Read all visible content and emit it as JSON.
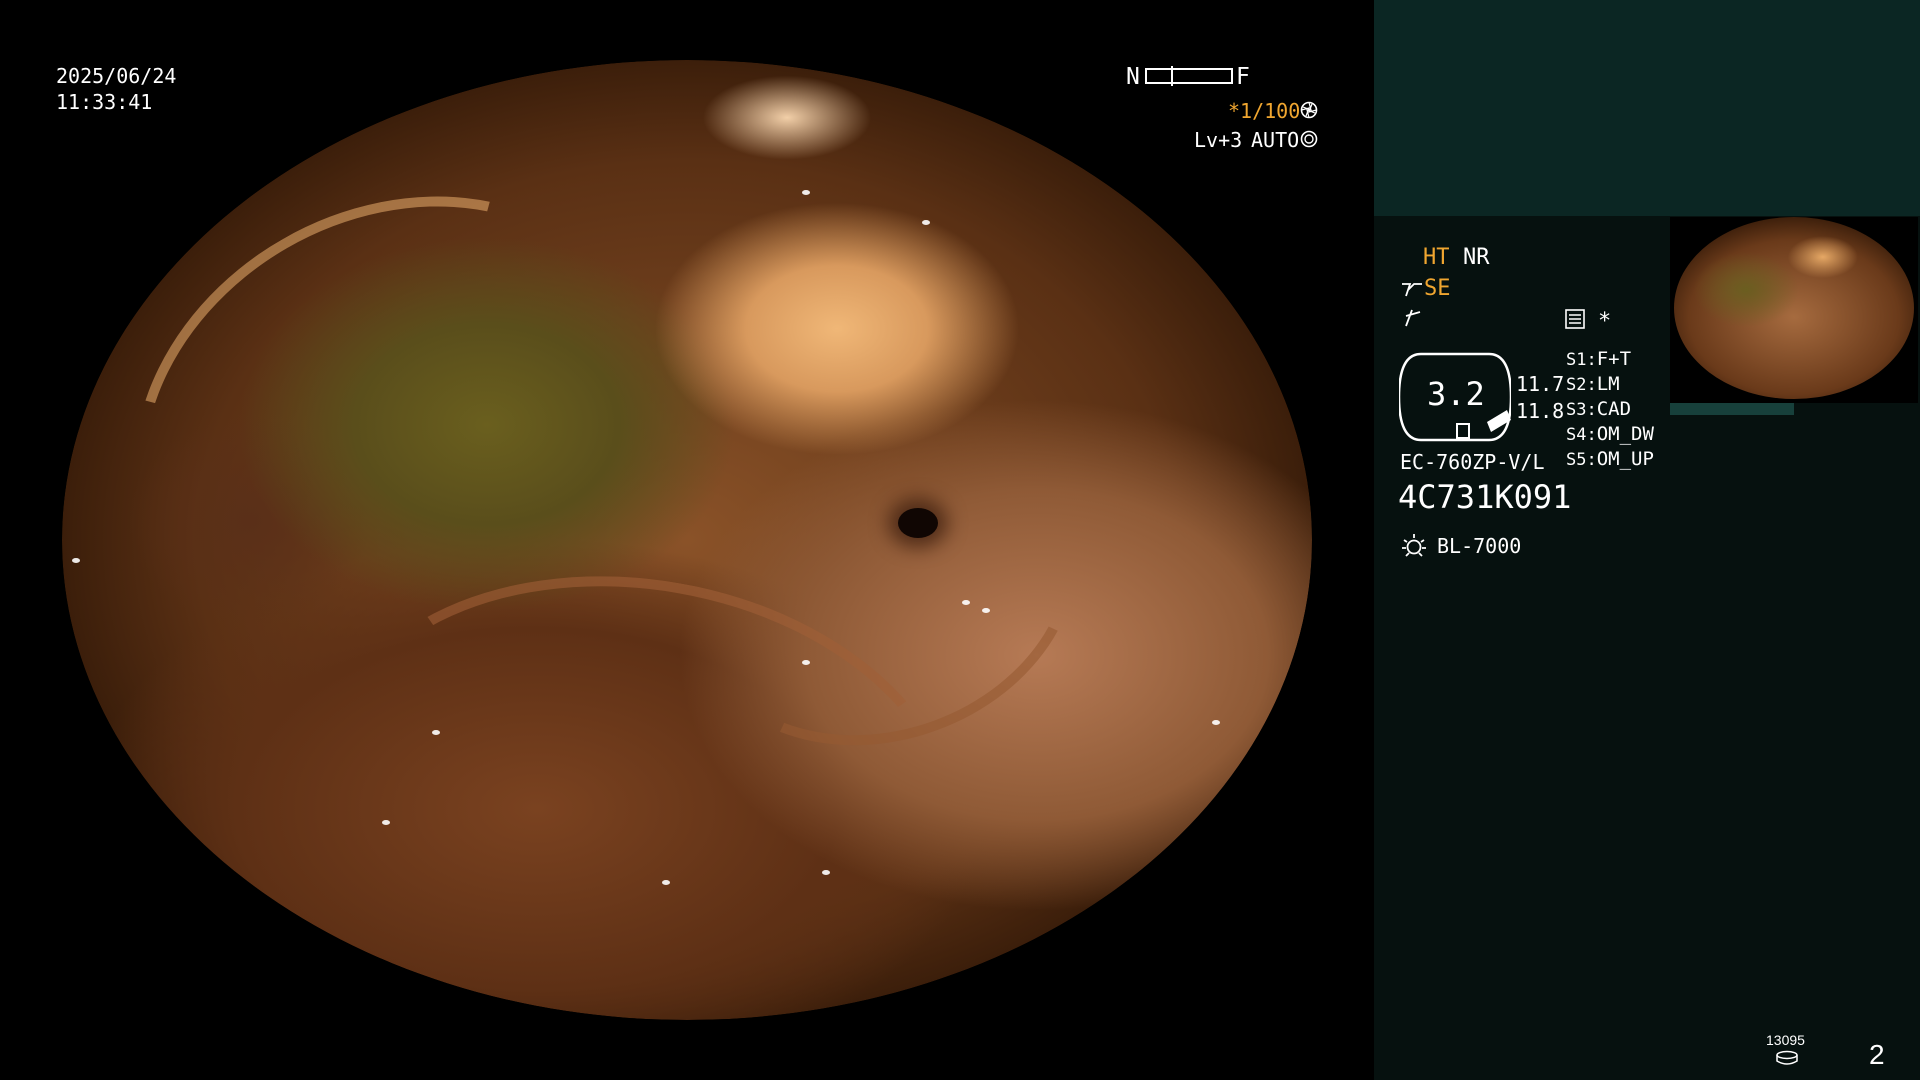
{
  "overlay": {
    "date": "2025/06/24",
    "time": "11:33:41",
    "focus_near": "N",
    "focus_far": "F",
    "shutter": "*1/100",
    "level": "Lv+3",
    "iris_mode": "AUTO"
  },
  "panel": {
    "ht": "HT",
    "nr": "NR",
    "se": "SE",
    "asterisk": "*",
    "gauge_value": "3.2",
    "readout_1": "11.7",
    "readout_2": "11.8",
    "switches": [
      {
        "key": "S1:",
        "value": "F+T"
      },
      {
        "key": "S2:",
        "value": "LM"
      },
      {
        "key": "S3:",
        "value": "CAD"
      },
      {
        "key": "S4:",
        "value": "OM_DW"
      },
      {
        "key": "S5:",
        "value": "OM_UP"
      }
    ],
    "scope_model": "EC-760ZP-V/L",
    "serial": "4C731K091",
    "light_source": "BL-7000",
    "counter": "13095",
    "image_index": "2"
  },
  "icons": {
    "shutter_icon": "aperture-icon",
    "iris_icon": "iris-icon",
    "se_icon": "enhance-icon",
    "freeze_icon": "freeze-icon",
    "settings_icon": "menu-icon",
    "light_icon": "lamp-icon",
    "disk_icon": "storage-icon"
  },
  "colors": {
    "accent": "#f0a630",
    "panel_top": "#0b2623",
    "panel_bg": "#06110f"
  }
}
